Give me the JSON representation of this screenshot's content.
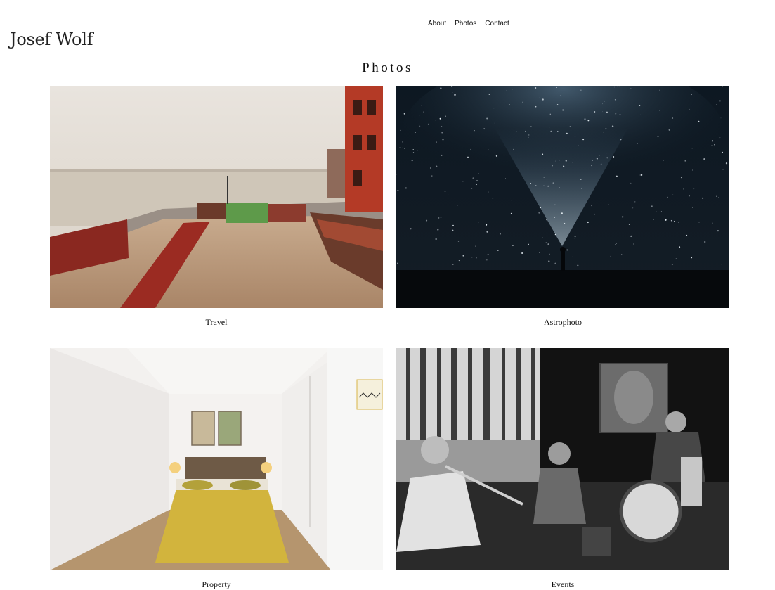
{
  "site": {
    "title": "Josef Wolf"
  },
  "nav": {
    "items": [
      {
        "label": "About"
      },
      {
        "label": "Photos"
      },
      {
        "label": "Contact"
      }
    ]
  },
  "page": {
    "title": "Photos"
  },
  "gallery": {
    "items": [
      {
        "caption": "Travel",
        "image": "travel-rooftop-river-photo"
      },
      {
        "caption": "Astrophoto",
        "image": "night-sky-milky-way-photo"
      },
      {
        "caption": "Property",
        "image": "bedroom-interior-photo"
      },
      {
        "caption": "Events",
        "image": "live-music-band-photo"
      }
    ]
  }
}
